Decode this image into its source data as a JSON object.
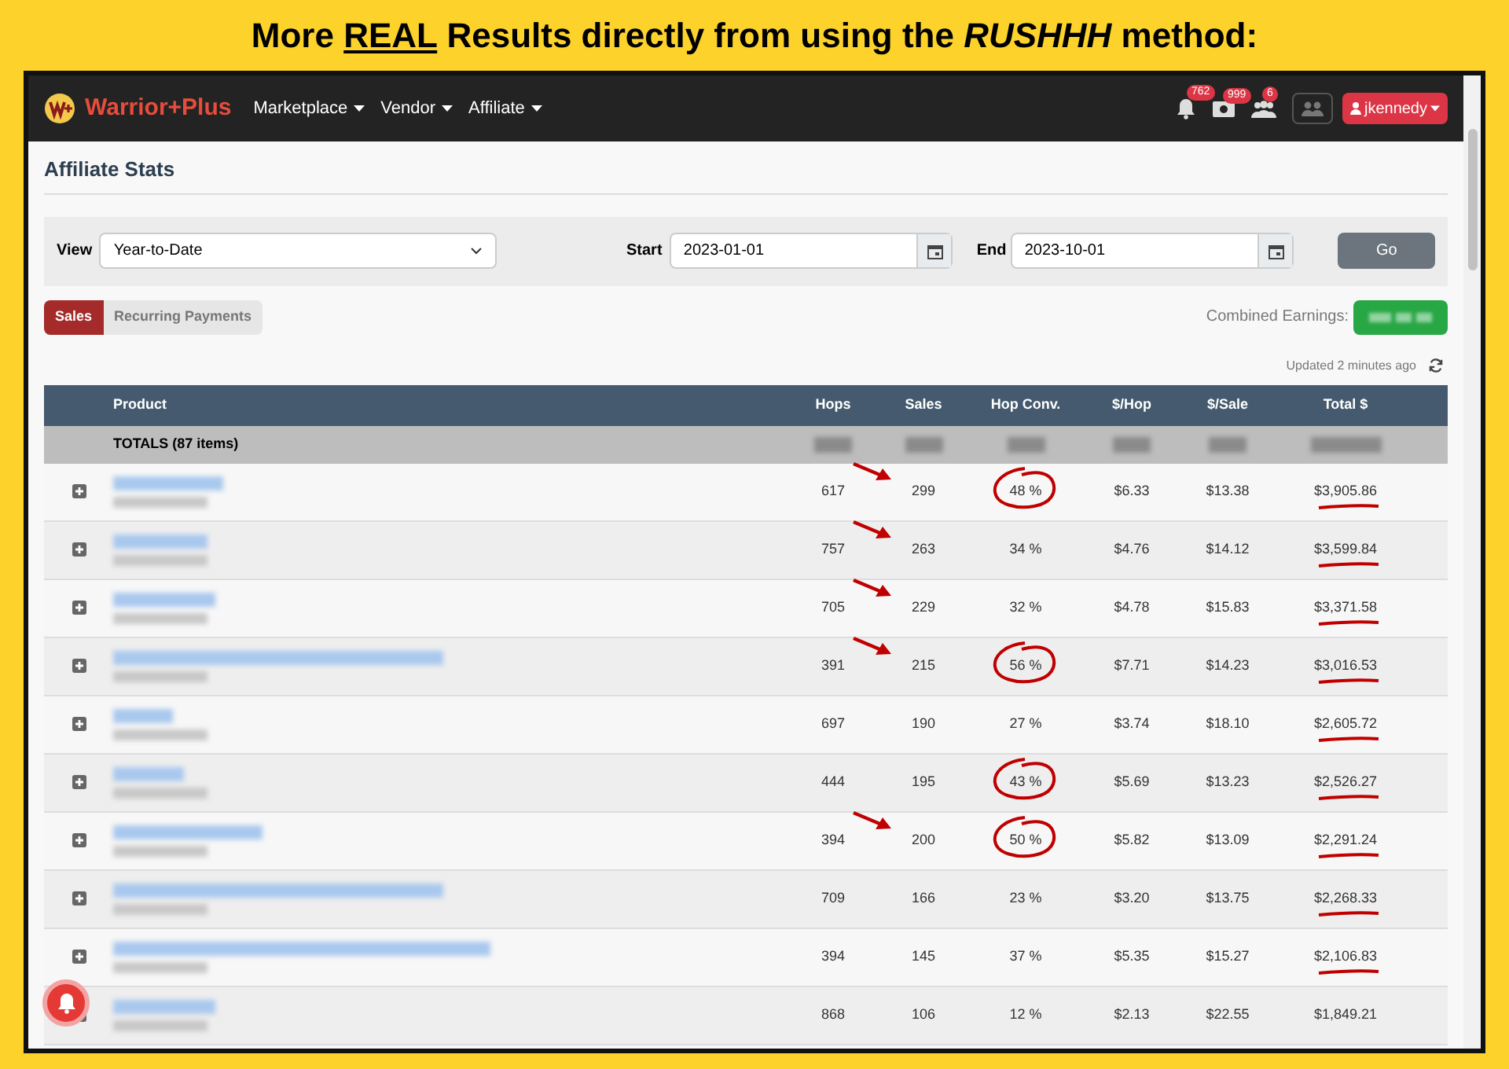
{
  "headline": {
    "before": "More ",
    "underlined": "REAL",
    "middle": " Results directly from using the ",
    "italic": "RUSHHH",
    "after": " method:"
  },
  "navbar": {
    "logo": "Warrior+Plus",
    "menus": [
      "Marketplace",
      "Vendor",
      "Affiliate"
    ],
    "badges": [
      {
        "kind": "bell",
        "count": "762"
      },
      {
        "kind": "money",
        "count": "999"
      },
      {
        "kind": "people",
        "count": "6"
      }
    ],
    "user": "jkennedy"
  },
  "page_title": "Affiliate Stats",
  "filters": {
    "view_label": "View",
    "view_value": "Year-to-Date",
    "start_label": "Start",
    "start_value": "2023-01-01",
    "end_label": "End",
    "end_value": "2023-10-01",
    "go": "Go"
  },
  "tabs": [
    {
      "label": "Sales",
      "selected": true
    },
    {
      "label": "Recurring Payments",
      "selected": false
    }
  ],
  "combined_label": "Combined Earnings:",
  "updated": "Updated 2 minutes ago",
  "table": {
    "columns": [
      "Product",
      "Hops",
      "Sales",
      "Hop Conv.",
      "$/Hop",
      "$/Sale",
      "Total $"
    ],
    "totals_label": "TOTALS (87 items)",
    "rows": [
      {
        "hops": "617",
        "sales": "299",
        "conv": "48 %",
        "per_hop": "$6.33",
        "per_sale": "$13.38",
        "total": "$3,905.86",
        "arrow": true,
        "circled": true,
        "underlined": true
      },
      {
        "hops": "757",
        "sales": "263",
        "conv": "34 %",
        "per_hop": "$4.76",
        "per_sale": "$14.12",
        "total": "$3,599.84",
        "arrow": true,
        "circled": false,
        "underlined": true
      },
      {
        "hops": "705",
        "sales": "229",
        "conv": "32 %",
        "per_hop": "$4.78",
        "per_sale": "$15.83",
        "total": "$3,371.58",
        "arrow": true,
        "circled": false,
        "underlined": true
      },
      {
        "hops": "391",
        "sales": "215",
        "conv": "56 %",
        "per_hop": "$7.71",
        "per_sale": "$14.23",
        "total": "$3,016.53",
        "arrow": true,
        "circled": true,
        "underlined": true
      },
      {
        "hops": "697",
        "sales": "190",
        "conv": "27 %",
        "per_hop": "$3.74",
        "per_sale": "$18.10",
        "total": "$2,605.72",
        "arrow": false,
        "circled": false,
        "underlined": true
      },
      {
        "hops": "444",
        "sales": "195",
        "conv": "43 %",
        "per_hop": "$5.69",
        "per_sale": "$13.23",
        "total": "$2,526.27",
        "arrow": false,
        "circled": true,
        "underlined": true
      },
      {
        "hops": "394",
        "sales": "200",
        "conv": "50 %",
        "per_hop": "$5.82",
        "per_sale": "$13.09",
        "total": "$2,291.24",
        "arrow": true,
        "circled": true,
        "underlined": true
      },
      {
        "hops": "709",
        "sales": "166",
        "conv": "23 %",
        "per_hop": "$3.20",
        "per_sale": "$13.75",
        "total": "$2,268.33",
        "arrow": false,
        "circled": false,
        "underlined": true
      },
      {
        "hops": "394",
        "sales": "145",
        "conv": "37 %",
        "per_hop": "$5.35",
        "per_sale": "$15.27",
        "total": "$2,106.83",
        "arrow": false,
        "circled": false,
        "underlined": true
      },
      {
        "hops": "868",
        "sales": "106",
        "conv": "12 %",
        "per_hop": "$2.13",
        "per_sale": "$22.55",
        "total": "$1,849.21",
        "arrow": false,
        "circled": false,
        "underlined": false
      }
    ]
  }
}
